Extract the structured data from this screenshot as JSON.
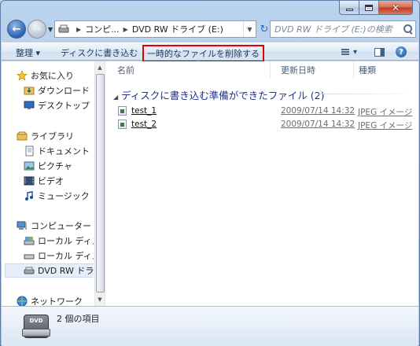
{
  "address": {
    "segments": [
      "コンピ...",
      "DVD RW ドライブ (E:)"
    ]
  },
  "search": {
    "placeholder": "DVD RW ドライブ (E:)の検索"
  },
  "commands": {
    "organize": "整理 ▾",
    "burn": "ディスクに書き込む",
    "delete_temp": "一時的なファイルを削除する"
  },
  "nav": {
    "items": [
      {
        "label": "お気に入り",
        "icon": "star-icon"
      },
      {
        "label": "ダウンロード",
        "icon": "downloads-folder-icon"
      },
      {
        "label": "デスクトップ",
        "icon": "desktop-icon"
      },
      {
        "label": "ライブラリ",
        "icon": "library-icon"
      },
      {
        "label": "ドキュメント",
        "icon": "documents-icon"
      },
      {
        "label": "ピクチャ",
        "icon": "pictures-icon"
      },
      {
        "label": "ビデオ",
        "icon": "videos-icon"
      },
      {
        "label": "ミュージック",
        "icon": "music-icon"
      },
      {
        "label": "コンピューター",
        "icon": "computer-icon"
      },
      {
        "label": "ローカル ディス",
        "icon": "system-drive-icon"
      },
      {
        "label": "ローカル ディス",
        "icon": "local-drive-icon"
      },
      {
        "label": "DVD RW ドライ",
        "icon": "dvd-drive-icon"
      },
      {
        "label": "ネットワーク",
        "icon": "network-icon"
      }
    ]
  },
  "columns": {
    "name": "名前",
    "modified": "更新日時",
    "type": "種類"
  },
  "group": {
    "title": "ディスクに書き込む準備ができたファイル (2)"
  },
  "files": [
    {
      "name": "test_1",
      "date": "2009/07/14 14:32",
      "type": "JPEG イメージ"
    },
    {
      "name": "test_2",
      "date": "2009/07/14 14:32",
      "type": "JPEG イメージ"
    }
  ],
  "details": {
    "count": "2 個の項目"
  },
  "colors": {
    "highlight_border": "#e20000",
    "group_header": "#1e3287"
  }
}
